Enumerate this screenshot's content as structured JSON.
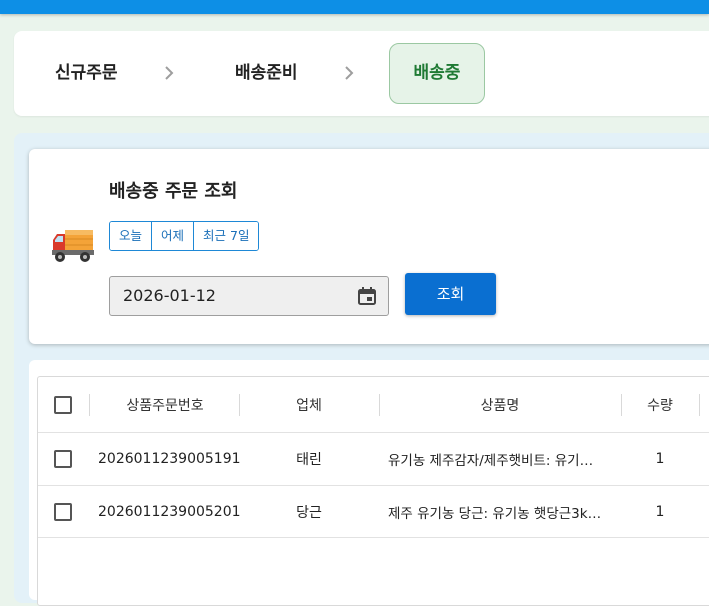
{
  "steps": {
    "items": [
      {
        "label": "신규주문"
      },
      {
        "label": "배송준비"
      },
      {
        "label": "배송중"
      }
    ],
    "active_index": 2
  },
  "search": {
    "title": "배송중 주문 조회",
    "icon": "delivery-truck-icon",
    "ranges": [
      "오늘",
      "어제",
      "최근 7일"
    ],
    "date_value": "2026-01-12",
    "search_button": "조회"
  },
  "table": {
    "headers": {
      "order_no": "상품주문번호",
      "vendor": "업체",
      "product": "상품명",
      "qty": "수량"
    },
    "rows": [
      {
        "order_no": "2026011239005191",
        "vendor": "태린",
        "product": "유기농 제주감자/제주햇비트: 유기농 …",
        "qty": "1"
      },
      {
        "order_no": "2026011239005201",
        "vendor": "당근",
        "product": "제주 유기농 당근: 유기농 햇당근3kg(…",
        "qty": "1"
      }
    ]
  },
  "colors": {
    "top_bar": "#0d8fe6",
    "active_step_bg": "#e6f3e8",
    "active_step_text": "#1f7a34",
    "primary_button": "#0a6fd1"
  }
}
